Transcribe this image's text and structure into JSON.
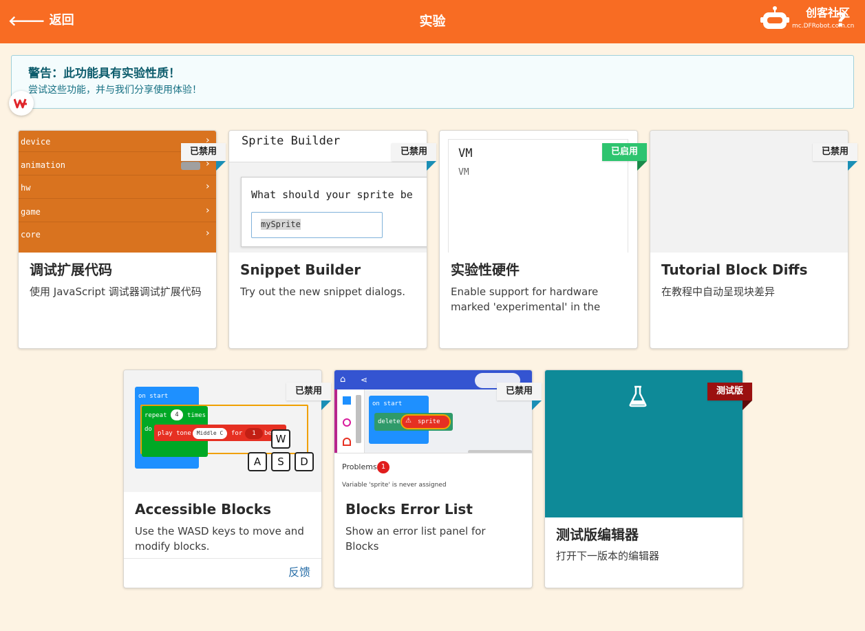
{
  "header": {
    "back_label": "返回",
    "title": "实验",
    "logo_text": "创客社区",
    "logo_url": "mc.DFRobot.com.cn",
    "help_label": "?"
  },
  "warning": {
    "title": "警告：此功能具有实验性质！",
    "description": "尝试这些功能，并与我们分享使用体验！"
  },
  "cards": [
    {
      "title": "调试扩展代码",
      "description": "使用 JavaScript 调试器调试扩展代码",
      "status": "已禁用"
    },
    {
      "title": "Snippet Builder",
      "description": "Try out the new snippet dialogs.",
      "status": "已禁用"
    },
    {
      "title": "实验性硬件",
      "description": "Enable support for hardware marked 'experimental' in the",
      "status": "已启用"
    },
    {
      "title": "Tutorial Block Diffs",
      "description": "在教程中自动呈现块差异",
      "status": "已禁用"
    },
    {
      "title": "Accessible Blocks",
      "description": "Use the WASD keys to move and modify blocks.",
      "status": "已禁用",
      "feedback": "反馈"
    },
    {
      "title": "Blocks Error List",
      "description": "Show an error list panel for Blocks",
      "status": "已禁用"
    },
    {
      "title": "测试版编辑器",
      "description": "打开下一版本的编辑器",
      "status": "测试版"
    }
  ],
  "previews": {
    "debug_categories": [
      "device",
      "animation",
      "hw",
      "game",
      "core"
    ],
    "sprite_builder_title": "Sprite Builder",
    "sprite_question": "What should your sprite be",
    "sprite_input_value": "mySprite",
    "vm_heading": "VM",
    "vm_text": "VM",
    "access_blocks": {
      "on_start": "on start",
      "repeat": "repeat",
      "repeat_count": "4",
      "times": "times",
      "do": "do",
      "play_tone": "play tone",
      "note": "Middle C",
      "for": "for",
      "beats": "1",
      "be": "be"
    },
    "keys": [
      "W",
      "A",
      "S",
      "D"
    ],
    "error_list": {
      "on_start": "on start",
      "delete": "delete",
      "sprite": "sprite",
      "problems": "Problems",
      "problem_count": "1",
      "message": "Variable 'sprite' is never assigned"
    }
  },
  "colors": {
    "header": "#f86c23",
    "background": "#fdf3e3",
    "enabled": "#2ec46f",
    "beta": "#9b1010",
    "corner": "#1b8fb5"
  }
}
